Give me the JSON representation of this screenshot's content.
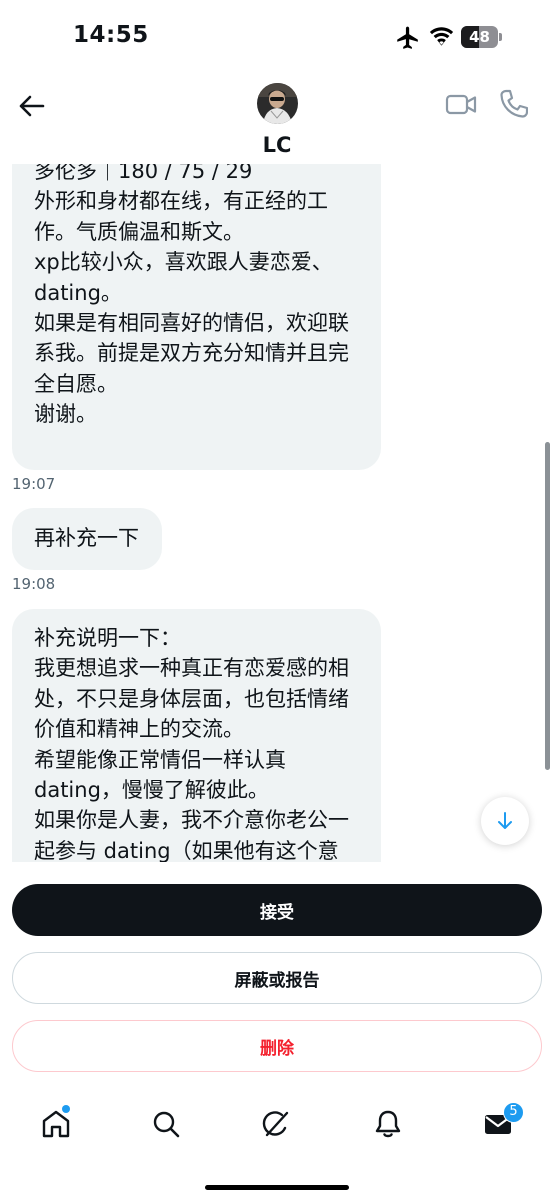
{
  "status_bar": {
    "time": "14:55",
    "battery": "48",
    "battery_level": 0.48,
    "icons": [
      "airplane-icon",
      "wifi-icon",
      "battery-icon"
    ]
  },
  "header": {
    "contact_name": "LC",
    "icons": [
      "back-arrow-icon",
      "video-camera-icon",
      "phone-icon"
    ]
  },
  "messages": [
    {
      "text": "多伦多｜180 / 75 / 29\n外形和身材都在线，有正经的工\n作。气质偏温和斯文。\nxp比较小众，喜欢跟人妻恋爱、\ndating。\n如果是有相同喜好的情侣，欢迎联\n系我。前提是双方充分知情并且完\n全自愿。\n谢谢。",
      "time": "19:07"
    },
    {
      "text": "再补充一下",
      "time": "19:08"
    },
    {
      "text": "补充说明一下：\n我更想追求一种真正有恋爱感的相\n处，不只是身体层面，也包括情绪\n价值和精神上的交流。\n希望能像正常情侣一样认真\ndating，慢慢了解彼此。\n如果你是人妻，我不介意你老公一\n起参与 dating（如果他有这个意",
      "time": ""
    }
  ],
  "actions": {
    "accept": "接受",
    "block_report": "屏蔽或报告",
    "delete": "删除"
  },
  "tab_bar": {
    "items": [
      "home-icon",
      "search-icon",
      "grok-icon",
      "bell-icon",
      "mail-icon"
    ],
    "messages_badge": "5"
  },
  "colors": {
    "accent": "#1d9bf0",
    "bubble": "#eff3f4",
    "text": "#0f1419",
    "secondary_text": "#536471",
    "danger": "#f4212e"
  }
}
